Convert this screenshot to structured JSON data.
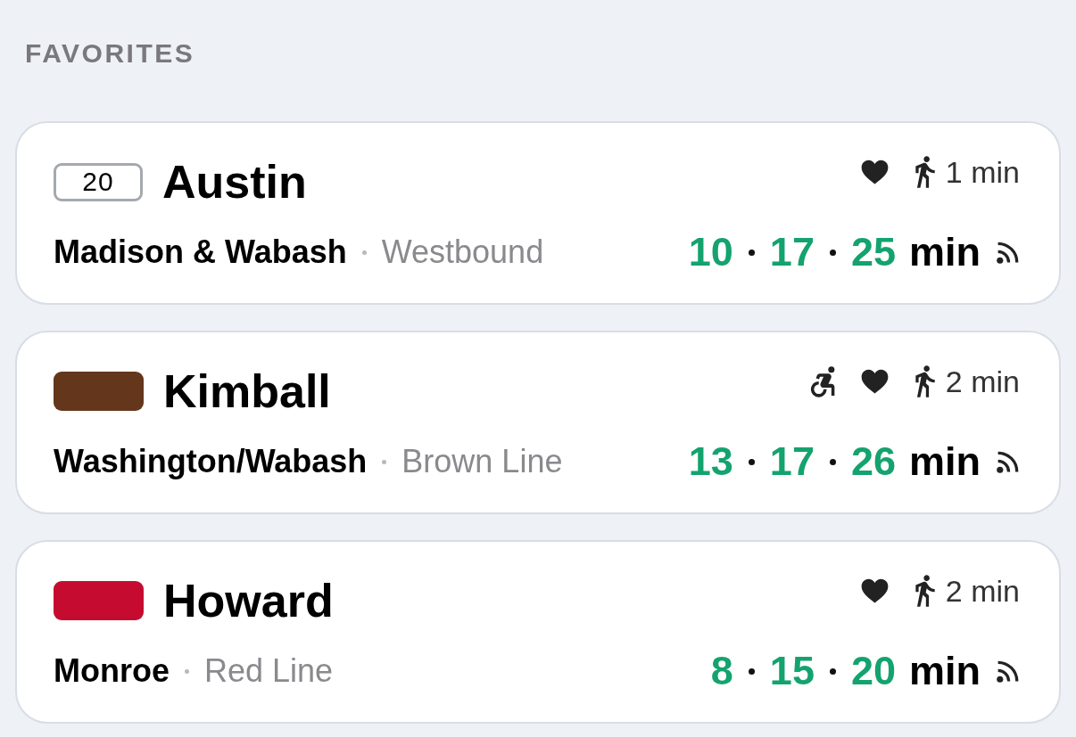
{
  "section_title": "FAVORITES",
  "favorites": [
    {
      "route_badge": {
        "kind": "bus",
        "label": "20"
      },
      "destination": "Austin",
      "accessible": false,
      "favorited": true,
      "walk_time": "1 min",
      "stop": "Madison & Wabash",
      "direction": "Westbound",
      "arrivals": [
        "10",
        "17",
        "25"
      ],
      "unit": "min",
      "realtime": true
    },
    {
      "route_badge": {
        "kind": "train",
        "color": "#64361c"
      },
      "destination": "Kimball",
      "accessible": true,
      "favorited": true,
      "walk_time": "2 min",
      "stop": "Washington/Wabash",
      "direction": "Brown Line",
      "arrivals": [
        "13",
        "17",
        "26"
      ],
      "unit": "min",
      "realtime": true
    },
    {
      "route_badge": {
        "kind": "train",
        "color": "#c50c30"
      },
      "destination": "Howard",
      "accessible": false,
      "favorited": true,
      "walk_time": "2 min",
      "stop": "Monroe",
      "direction": "Red Line",
      "arrivals": [
        "8",
        "15",
        "20"
      ],
      "unit": "min",
      "realtime": true
    }
  ]
}
